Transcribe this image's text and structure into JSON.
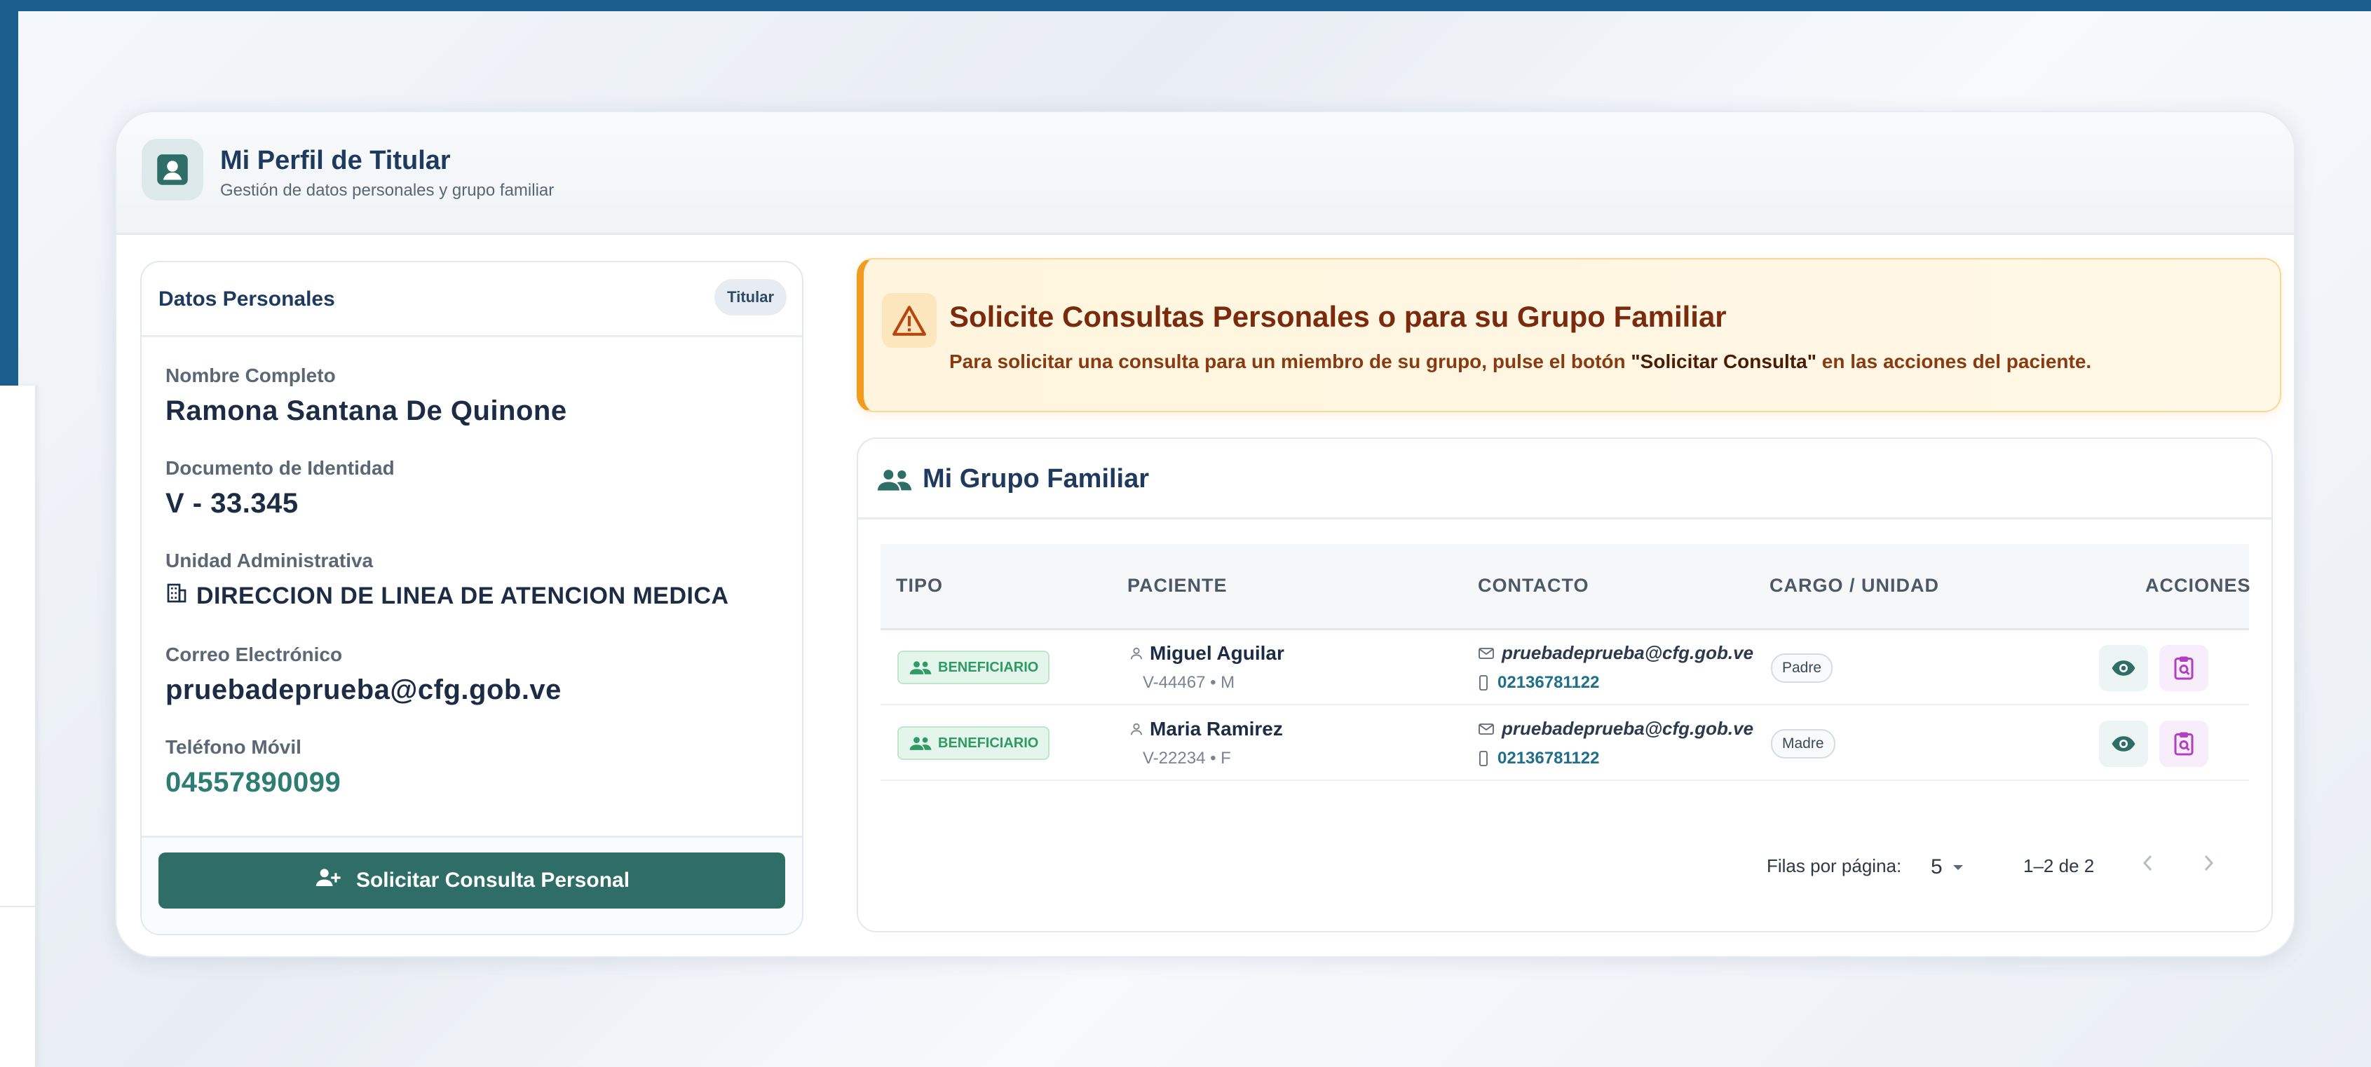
{
  "header": {
    "title": "Mi Perfil de Titular",
    "subtitle": "Gestión de datos personales y grupo familiar"
  },
  "personal": {
    "section_title": "Datos Personales",
    "badge": "Titular",
    "fields": [
      {
        "label": "Nombre Completo",
        "value": "Ramona Santana De Quinone"
      },
      {
        "label": "Documento de Identidad",
        "value": "V - 33.345"
      },
      {
        "label": "Unidad Administrativa",
        "value": "DIRECCION DE LINEA DE ATENCION MEDICA"
      },
      {
        "label": "Correo Electrónico",
        "value": "pruebadeprueba@cfg.gob.ve"
      },
      {
        "label": "Teléfono Móvil",
        "value": "04557890099"
      }
    ],
    "button_label": "Solicitar Consulta Personal"
  },
  "alert": {
    "title": "Solicite Consultas Personales o para su Grupo Familiar",
    "message_before": "Para solicitar una consulta para un miembro de su grupo, pulse el botón ",
    "message_bold": "\"Solicitar Consulta\"",
    "message_after": " en las acciones del paciente."
  },
  "group": {
    "title": "Mi Grupo Familiar",
    "columns": [
      "TIPO",
      "PACIENTE",
      "CONTACTO",
      "CARGO / UNIDAD",
      "ACCIONES"
    ],
    "rows": [
      {
        "tipo": "BENEFICIARIO",
        "name": "Miguel Aguilar",
        "doc": "V-44467 • M",
        "email": "pruebadeprueba@cfg.gob.ve",
        "phone": "02136781122",
        "cargo": "Padre"
      },
      {
        "tipo": "BENEFICIARIO",
        "name": "Maria Ramirez",
        "doc": "V-22234 • F",
        "email": "pruebadeprueba@cfg.gob.ve",
        "phone": "02136781122",
        "cargo": "Madre"
      }
    ],
    "pagination": {
      "rows_label": "Filas por página:",
      "rows_value": "5",
      "range": "1–2 de 2"
    }
  },
  "colors": {
    "primary": "#2e6e67",
    "title": "#1e3a5f",
    "alert_accent": "#f29c1f",
    "beneficiary": "#2f9a63"
  }
}
